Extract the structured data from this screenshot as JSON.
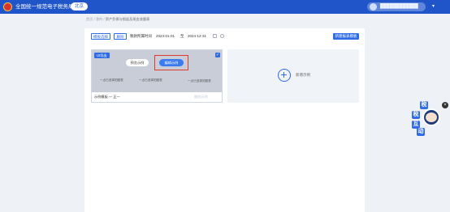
{
  "header": {
    "title": "全国统一规范电子税务局",
    "region": "北京",
    "user_name": "████████████",
    "brand_color": "#1f55c9"
  },
  "breadcrumb": {
    "items": [
      "首页",
      "我的",
      "资产负债与损益及现金流量表"
    ]
  },
  "toolbar": {
    "btn_template": "模板选择",
    "btn_delete": "删除",
    "period_label": "税款所属时间",
    "date_start": "2024-01-01",
    "date_separator": "至",
    "date_end": "2024-12-31",
    "btn_new": "新建报表模板"
  },
  "card": {
    "tag": "UI导出",
    "preview_label": "预览示例",
    "edit_label": "编辑示例",
    "placeholders": [
      "一点已选择的图表",
      "一点已选择的图表",
      "一点已选择的图表"
    ],
    "footer_name": "示例模板 — 正一",
    "footer_action": "删除示例"
  },
  "add_card": {
    "label": "新增示例"
  },
  "mascot": {
    "chars": [
      "税",
      "税",
      "互",
      "动"
    ]
  },
  "colors": {
    "accent": "#2f6be6",
    "highlight": "#e03a2e"
  }
}
